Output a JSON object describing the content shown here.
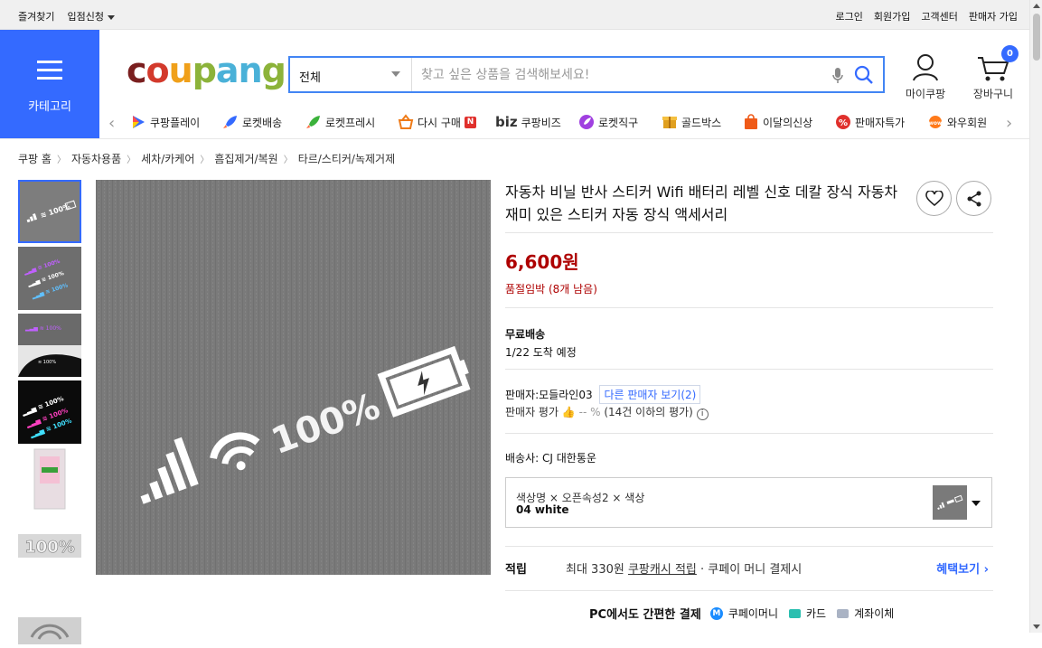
{
  "topbar": {
    "favorites": "즐겨찾기",
    "partner": "입점신청",
    "login": "로그인",
    "signup": "회원가입",
    "support": "고객센터",
    "seller_join": "판매자 가입"
  },
  "header": {
    "category_label": "카테고리",
    "logo": "coupang",
    "search_category": "전체",
    "search_placeholder": "찾고 싶은 상품을 검색해보세요!",
    "mycoupang": "마이쿠팡",
    "cart": "장바구니",
    "cart_count": "0"
  },
  "services": [
    {
      "label": "쿠팡플레이",
      "icon": "play-icon",
      "color": "#346aff"
    },
    {
      "label": "로켓배송",
      "icon": "rocket-icon",
      "color": "#346aff"
    },
    {
      "label": "로켓프레시",
      "icon": "rocket-fresh-icon",
      "color": "#3bb23b"
    },
    {
      "label": "다시 구매",
      "icon": "basket-icon",
      "color": "#ef7b18"
    },
    {
      "label": "쿠팡비즈",
      "icon": "biz-icon",
      "color": "#333333"
    },
    {
      "label": "로켓직구",
      "icon": "rocket-global-icon",
      "color": "#a040e0"
    },
    {
      "label": "골드박스",
      "icon": "goldbox-icon",
      "color": "#e0a020"
    },
    {
      "label": "이달의신상",
      "icon": "shopping-bag-icon",
      "color": "#ef5a18"
    },
    {
      "label": "판매자특가",
      "icon": "percent-icon",
      "color": "#e0302c"
    },
    {
      "label": "와우회원",
      "icon": "wow-icon",
      "color": "#346aff"
    }
  ],
  "breadcrumb": [
    "쿠팡 홈",
    "자동차용품",
    "세차/카케어",
    "흠집제거/복원",
    "타르/스티커/녹제거제"
  ],
  "product": {
    "title": "자동차 비닐 반사 스티커 Wifi 배터리 레벨 신호 데칼 장식 자동차 재미 있은 스티커 자동 장식 액세서리",
    "price": "6,600원",
    "stock_note": "품절임박 (8개 남음)",
    "shipping_title": "무료배송",
    "shipping_date": "1/22 도착 예정",
    "seller_prefix": "판매자:",
    "seller_name": "모들라인03",
    "seller_more": "다른 판매자 보기(2)",
    "rating_label": "판매자 평가",
    "rating_value": "-- %",
    "rating_note": "(14건 이하의 평가)",
    "courier_label": "배송사:",
    "courier_name": "CJ 대한통운",
    "option_labels": "색상명 × 오픈속성2 × 색상",
    "option_value": "04 white",
    "sticker_text": "100%",
    "reward_title": "적립",
    "reward_prefix": "최대 330원",
    "reward_link": "쿠팡캐시 적립",
    "reward_suffix": "· 쿠페이 머니 결제시",
    "reward_button": "혜택보기",
    "pay_title": "PC에서도 간편한 결제",
    "pay_money": "쿠페이머니",
    "pay_card": "카드",
    "pay_bank": "계좌이체"
  }
}
